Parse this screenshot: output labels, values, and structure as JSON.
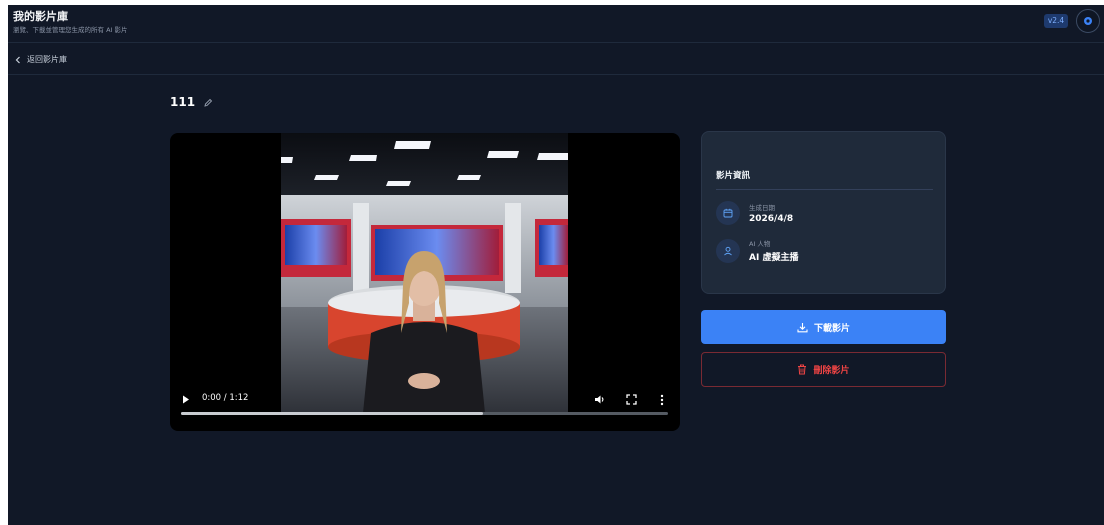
{
  "header": {
    "title": "我的影片庫",
    "subtitle": "瀏覽、下載並管理您生成的所有 AI 影片",
    "version": "v2.4"
  },
  "nav": {
    "back_label": "返回影片庫"
  },
  "video": {
    "title": "111",
    "time_display": "0:00 / 1:12",
    "buffered_fraction": 0.62
  },
  "info": {
    "heading": "影片資訊",
    "rows": [
      {
        "label": "生成日期",
        "value": "2026/4/8",
        "icon": "calendar-icon"
      },
      {
        "label": "AI 人物",
        "value": "AI 虛擬主播",
        "icon": "person-icon"
      }
    ]
  },
  "actions": {
    "download_label": "下載影片",
    "delete_label": "刪除影片"
  },
  "colors": {
    "background": "#111827",
    "card": "#1f2a3a",
    "primary": "#3b82f6",
    "danger": "#ef4444"
  }
}
